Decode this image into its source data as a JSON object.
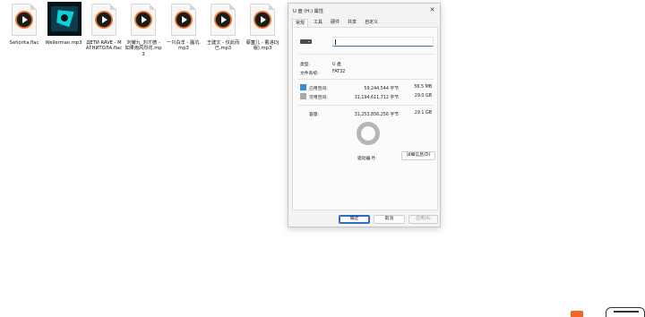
{
  "desktop": {
    "files": [
      {
        "label": "Señorita.flac",
        "icon": "audio-file-icon"
      },
      {
        "label": "Wellerman.mp3",
        "icon": "album-cover-icon"
      },
      {
        "label": "ДЕТИ RAVE - МАГНИТОЛА.flac",
        "icon": "audio-file-icon"
      },
      {
        "label": "刘耀九_刘才德 - 如果雨风烈花.mp3",
        "icon": "audio-file-icon"
      },
      {
        "label": "一只白羊 - 骚坑.mp3",
        "icon": "audio-file-icon"
      },
      {
        "label": "王建文 - 仅此而已.mp3",
        "icon": "audio-file-icon"
      },
      {
        "label": "蔡童儿 - 戴洛DJ版).mp3",
        "icon": "audio-file-icon"
      }
    ]
  },
  "dialog": {
    "title": "U 盘 (H:) 属性",
    "close_icon": "close-icon",
    "tabs": [
      "常规",
      "工具",
      "硬件",
      "共享",
      "自定义"
    ],
    "active_tab": "常规",
    "name_value": "",
    "type_label": "类型:",
    "type_value": "U 盘",
    "fs_label": "文件系统:",
    "fs_value": "FAT32",
    "used": {
      "label": "已用空间:",
      "bytes": "59,244,544 字节",
      "size": "56.5 MB",
      "color": "#2f90d8"
    },
    "free": {
      "label": "可用空间:",
      "bytes": "31,194,611,712 字节",
      "size": "29.0 GB",
      "color": "#a8a8a8"
    },
    "capacity": {
      "label": "容量:",
      "bytes": "31,253,856,256 字节",
      "size": "29.1 GB"
    },
    "drive_label": "驱动器 H:",
    "details_button": "详细信息(D)",
    "ok_button": "确定",
    "cancel_button": "取消",
    "apply_button": "应用(A)"
  }
}
